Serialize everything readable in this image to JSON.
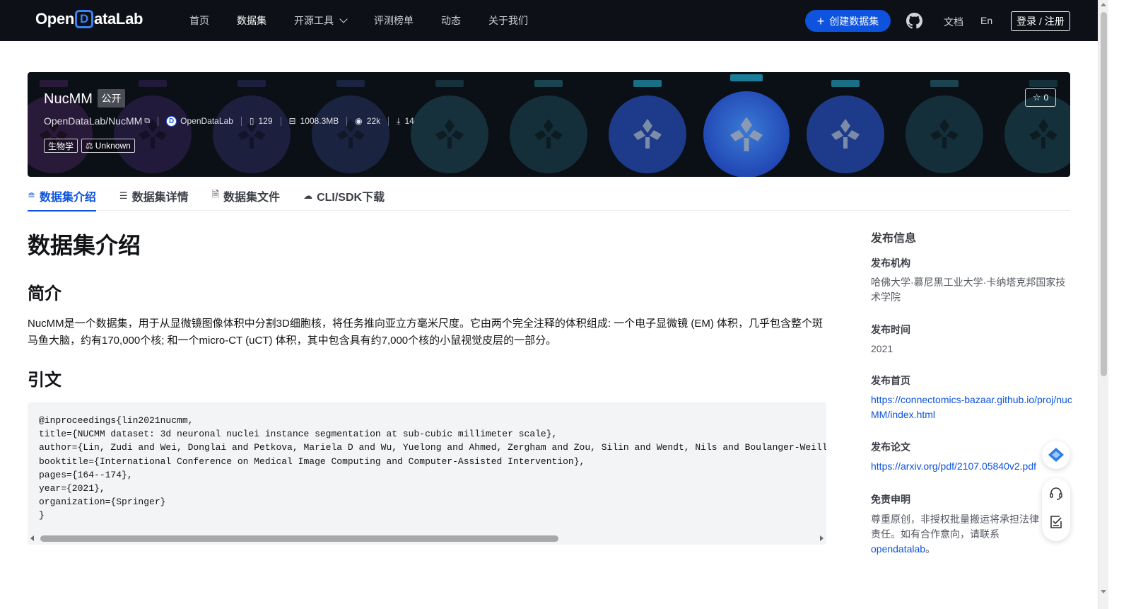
{
  "nav": {
    "logo": {
      "pre": "Open",
      "d": "D",
      "post": "ataLab"
    },
    "links": [
      {
        "label": "首页"
      },
      {
        "label": "数据集"
      },
      {
        "label": "开源工具"
      },
      {
        "label": "评测榜单"
      },
      {
        "label": "动态"
      },
      {
        "label": "关于我们"
      }
    ],
    "create_label": "创建数据集",
    "doc_label": "文档",
    "lang_label": "En",
    "login_label": "登录 / 注册"
  },
  "banner": {
    "title": "NucMM",
    "visibility": "公开",
    "repo": "OpenDataLab/NucMM",
    "org_name": "OpenDataLab",
    "files_count": "129",
    "size": "1008.3MB",
    "views": "22k",
    "downloads": "14",
    "tags": [
      "生物学",
      "Unknown"
    ],
    "stars": "0"
  },
  "tabs": [
    {
      "label": "数据集介绍",
      "icon": "database-icon",
      "glyph": "≘"
    },
    {
      "label": "数据集详情",
      "icon": "list-icon",
      "glyph": "☰"
    },
    {
      "label": "数据集文件",
      "icon": "file-icon",
      "glyph": "🗎"
    },
    {
      "label": "CLI/SDK下载",
      "icon": "cloud-download-icon",
      "glyph": "☁"
    }
  ],
  "main": {
    "h1": "数据集介绍",
    "intro_heading": "简介",
    "intro_text": "NucMM是一个数据集，用于从显微镜图像体积中分割3D细胞核，将任务推向亚立方毫米尺度。它由两个完全注释的体积组成: 一个电子显微镜 (EM) 体积，几乎包含整个斑马鱼大脑，约有170,000个核; 和一个micro-CT (uCT) 体积，其中包含具有约7,000个核的小鼠视觉皮层的一部分。",
    "citation_heading": "引文",
    "citation_code": "@inproceedings{lin2021nucmm,\ntitle={NUCMM dataset: 3d neuronal nuclei instance segmentation at sub-cubic millimeter scale},\nauthor={Lin, Zudi and Wei, Donglai and Petkova, Mariela D and Wu, Yuelong and Ahmed, Zergham and Zou, Silin and Wendt, Nils and Boulanger-Weill, Jonathan and others},\nbooktitle={International Conference on Medical Image Computing and Computer-Assisted Intervention},\npages={164--174},\nyear={2021},\norganization={Springer}\n}"
  },
  "sidebar": {
    "title": "发布信息",
    "org_label": "发布机构",
    "org_value": "哈佛大学·慕尼黑工业大学·卡纳塔克邦国家技术学院",
    "time_label": "发布时间",
    "time_value": "2021",
    "home_label": "发布首页",
    "home_link": "https://connectomics-bazaar.github.io/proj/nucMM/index.html",
    "paper_label": "发布论文",
    "paper_link": "https://arxiv.org/pdf/2107.05840v2.pdf",
    "disclaimer_label": "免责申明",
    "disclaimer_text": "尊重原创，非授权批量搬运将承担法律责任。如有合作意向，请联系",
    "disclaimer_link": "opendatalab",
    "disclaimer_end": "。"
  },
  "colors": {
    "accent": "#0d53de",
    "nav_bg": "#0d1117",
    "banner_bg": "#0b0f16"
  }
}
